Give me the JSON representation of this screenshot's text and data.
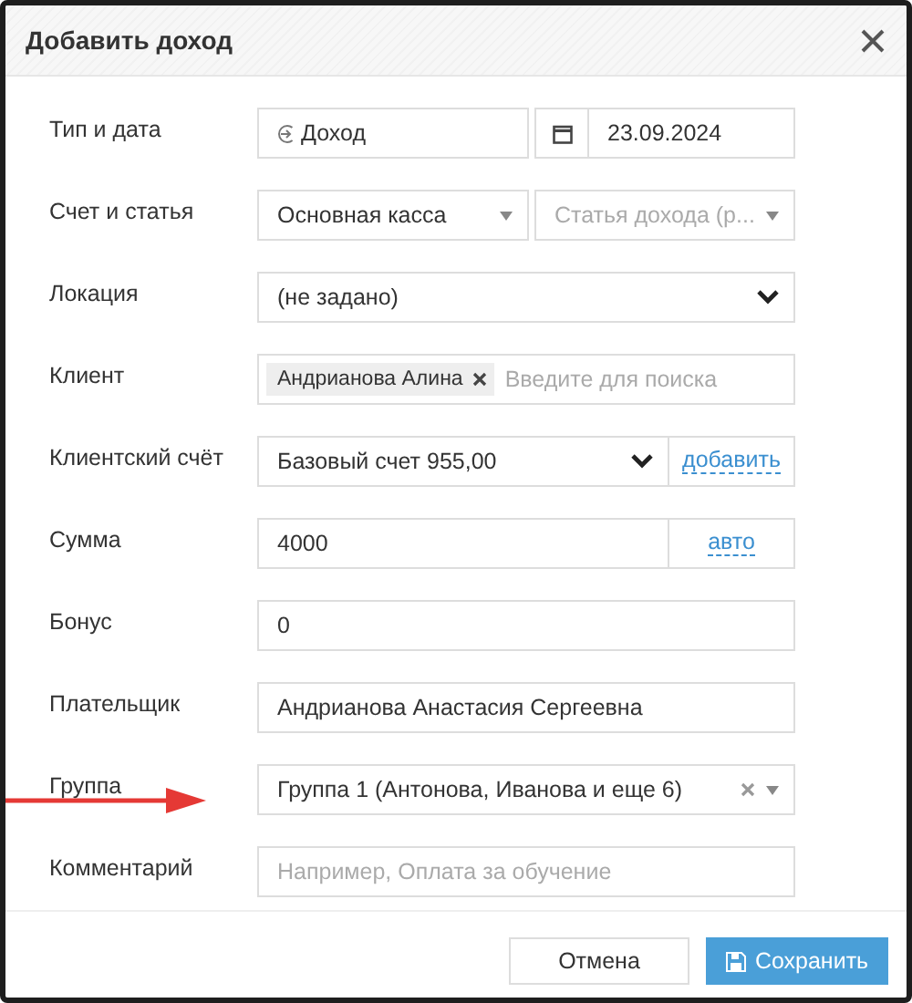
{
  "dialog": {
    "title": "Добавить доход",
    "rows": [
      {
        "kind": "type_date",
        "label": "Тип и дата",
        "type_value": "Доход",
        "date_value": "23.09.2024",
        "arrow": false
      },
      {
        "kind": "select_pair",
        "label": "Счет и статья",
        "value": "Основная касса",
        "placeholder": "Статья дохода (р...",
        "arrow": false
      },
      {
        "kind": "select",
        "label": "Локация",
        "value": "(не задано)",
        "arrow": false
      },
      {
        "kind": "tags",
        "label": "Клиент",
        "tags": [
          "Андрианова Алина"
        ],
        "placeholder": "Введите для поиска",
        "arrow": false
      },
      {
        "kind": "select_link",
        "label": "Клиентский счёт",
        "value": "Базовый счет 955,00",
        "link": "добавить",
        "arrow": false
      },
      {
        "kind": "input_link",
        "label": "Сумма",
        "value": "4000",
        "link": "авто",
        "arrow": false
      },
      {
        "kind": "input",
        "label": "Бонус",
        "value": "0",
        "arrow": false
      },
      {
        "kind": "input",
        "label": "Плательщик",
        "value": "Андрианова Анастасия Сергеевна",
        "arrow": false
      },
      {
        "kind": "clearable_select",
        "label": "Группа",
        "value": "Группа 1 (Антонова, Иванова и еще 6)",
        "arrow": true
      },
      {
        "kind": "input",
        "label": "Комментарий",
        "placeholder": "Например, Оплата за обучение",
        "arrow": false
      }
    ],
    "buttons": [
      {
        "kind": "secondary",
        "label": "Отмена"
      },
      {
        "kind": "primary",
        "label": "Сохранить"
      }
    ]
  }
}
